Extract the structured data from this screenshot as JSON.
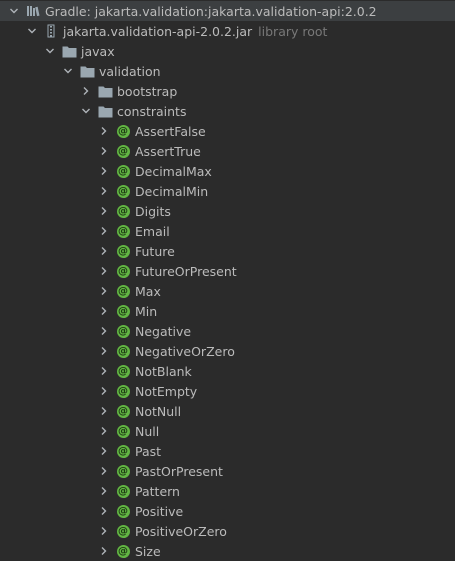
{
  "root": {
    "label": "Gradle: jakarta.validation:jakarta.validation-api:2.0.2",
    "icon": "gradle-library-icon"
  },
  "jar": {
    "label": "jakarta.validation-api-2.0.2.jar",
    "hint": "library root",
    "icon": "jar-icon"
  },
  "packages": {
    "javax": "javax",
    "validation": "validation",
    "bootstrap": "bootstrap",
    "constraints": "constraints"
  },
  "annotation_glyph": "@",
  "constraint_items": [
    "AssertFalse",
    "AssertTrue",
    "DecimalMax",
    "DecimalMin",
    "Digits",
    "Email",
    "Future",
    "FutureOrPresent",
    "Max",
    "Min",
    "Negative",
    "NegativeOrZero",
    "NotBlank",
    "NotEmpty",
    "NotNull",
    "Null",
    "Past",
    "PastOrPresent",
    "Pattern",
    "Positive",
    "PositiveOrZero",
    "Size"
  ],
  "colors": {
    "background": "#2b2b2b",
    "selected_row": "#3c3f41",
    "text": "#bbbbbb",
    "hint": "#787878",
    "annotation_icon": "#62b543",
    "folder": "#9aa7b0"
  }
}
